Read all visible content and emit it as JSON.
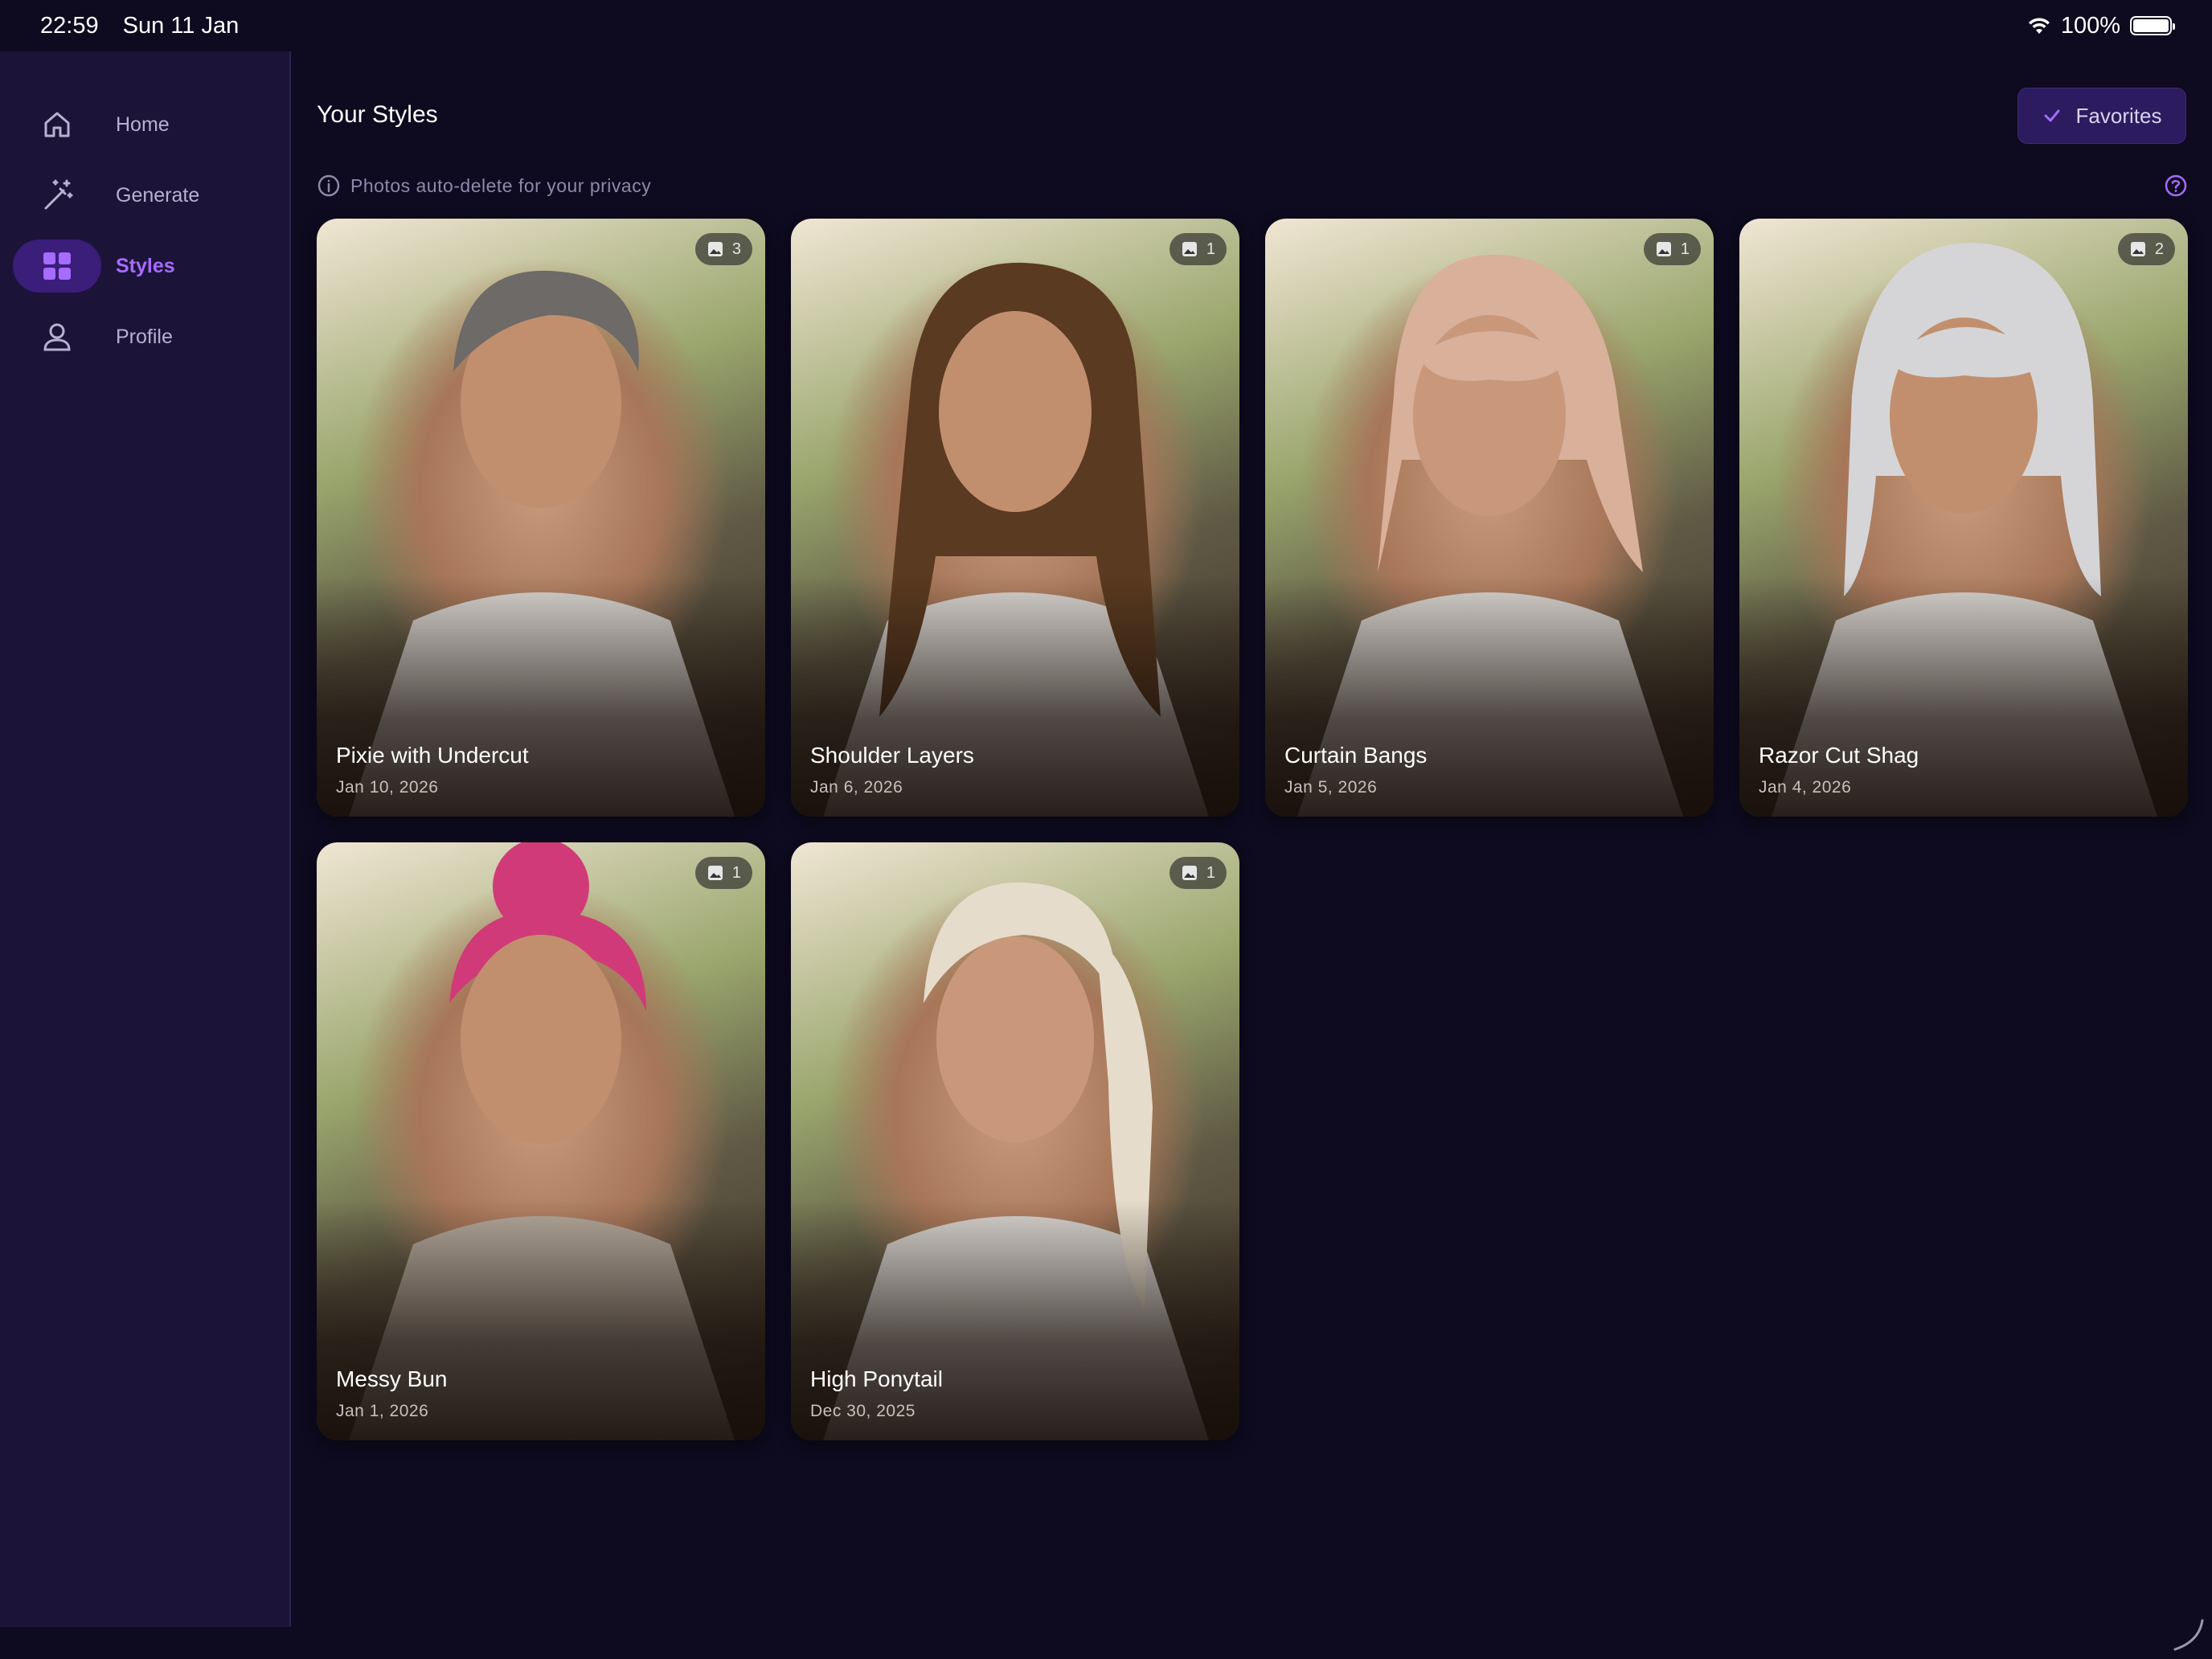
{
  "status": {
    "time": "22:59",
    "date": "Sun 11 Jan",
    "battery": "100%"
  },
  "sidebar": {
    "items": [
      {
        "label": "Home",
        "icon": "home-icon"
      },
      {
        "label": "Generate",
        "icon": "magic-wand-icon"
      },
      {
        "label": "Styles",
        "icon": "grid-icon",
        "active": true
      },
      {
        "label": "Profile",
        "icon": "person-icon"
      }
    ]
  },
  "main": {
    "title": "Your Styles",
    "favorites_label": "Favorites",
    "privacy_note": "Photos auto-delete for your privacy"
  },
  "cards": [
    {
      "title": "Pixie with Undercut",
      "date": "Jan 10, 2026",
      "count": "3",
      "hair_color": "#6d6a67"
    },
    {
      "title": "Shoulder Layers",
      "date": "Jan 6, 2026",
      "count": "1",
      "hair_color": "#5a3a20"
    },
    {
      "title": "Curtain Bangs",
      "date": "Jan 5, 2026",
      "count": "1",
      "hair_color": "#d9b09a"
    },
    {
      "title": "Razor Cut Shag",
      "date": "Jan 4, 2026",
      "count": "2",
      "hair_color": "#d5d5d8"
    },
    {
      "title": "Messy Bun",
      "date": "Jan 1, 2026",
      "count": "1",
      "hair_color": "#d13a78"
    },
    {
      "title": "High Ponytail",
      "date": "Dec 30, 2025",
      "count": "1",
      "hair_color": "#e6dccb"
    }
  ],
  "colors": {
    "accent": "#a66bff",
    "background": "#0e0a1f",
    "sidebar": "#1b1438"
  }
}
